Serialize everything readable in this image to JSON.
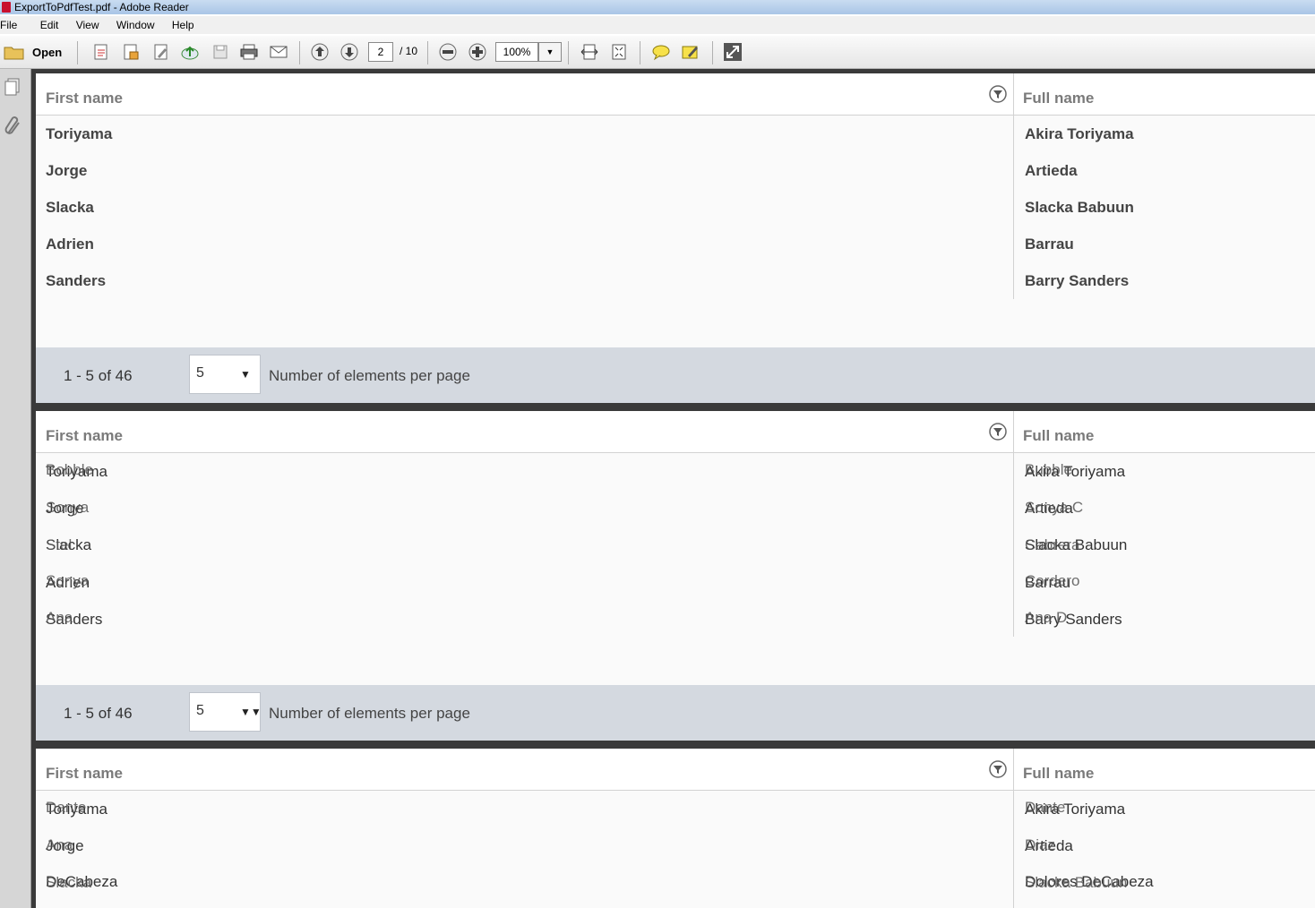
{
  "window": {
    "title": "ExportToPdfTest.pdf - Adobe Reader"
  },
  "menu": [
    "File",
    "Edit",
    "View",
    "Window",
    "Help"
  ],
  "toolbar": {
    "open_label": "Open",
    "page_current": "2",
    "page_total": "/ 10",
    "zoom": "100%",
    "icons": [
      "create-pdf-icon",
      "export-pdf-icon",
      "edit-icon",
      "upload-icon",
      "save-icon",
      "print-icon",
      "email-icon",
      "prev-page-icon",
      "next-page-icon",
      "zoom-out-icon",
      "zoom-in-icon",
      "fit-width-icon",
      "fit-page-icon",
      "comment-icon",
      "highlight-icon",
      "fullscreen-icon"
    ]
  },
  "pages": [
    {
      "header": {
        "col1": "First name",
        "col2": "Full name"
      },
      "rows": [
        {
          "first": "Toriyama",
          "full": "Akira Toriyama"
        },
        {
          "first": "Jorge",
          "full": "Artieda"
        },
        {
          "first": "Slacka",
          "full": "Slacka Babuun"
        },
        {
          "first": "Adrien",
          "full": "Barrau"
        },
        {
          "first": "Sanders",
          "full": "Barry Sanders"
        }
      ],
      "footer": {
        "range": "1 - 5 of 46",
        "per_page": "5",
        "label": "Number of elements per page"
      }
    },
    {
      "header": {
        "col1": "First name",
        "col2": "Full name"
      },
      "rows": [
        {
          "first": "Toriyama",
          "full": "Akira Toriyama",
          "ghost_first": "Bobble",
          "ghost_full": "Bubble"
        },
        {
          "first": "Jorge",
          "full": "Artieda",
          "ghost_first": "Sonya",
          "ghost_full": "Sonya C"
        },
        {
          "first": "Slacka",
          "full": "Slacka Babuun",
          "ghost_first": "Stel",
          "ghost_full": "Cabrera"
        },
        {
          "first": "Adrien",
          "full": "Barrau",
          "ghost_first": "Sonya",
          "ghost_full": "Cordero"
        },
        {
          "first": "Sanders",
          "full": "Barry Sanders",
          "ghost_first": "Ana",
          "ghost_full": "Ana D"
        }
      ],
      "footer": {
        "range": "1 - 5 of 46",
        "per_page": "5",
        "label": "Number of elements per page"
      }
    },
    {
      "header": {
        "col1": "First name",
        "col2": "Full name"
      },
      "rows": [
        {
          "first": "Toriyama",
          "full": "Akira Toriyama",
          "ghost_first": "Dante",
          "ghost_full": "Dante"
        },
        {
          "first": "Jorge",
          "full": "Artieda",
          "ghost_first": "Ana",
          "ghost_full": "Diaz"
        },
        {
          "first": "DeCabeza",
          "full": "Dolores DeCabeza",
          "ghost_first": "Slacka",
          "ghost_full": "Slacka Babuun"
        }
      ]
    }
  ]
}
